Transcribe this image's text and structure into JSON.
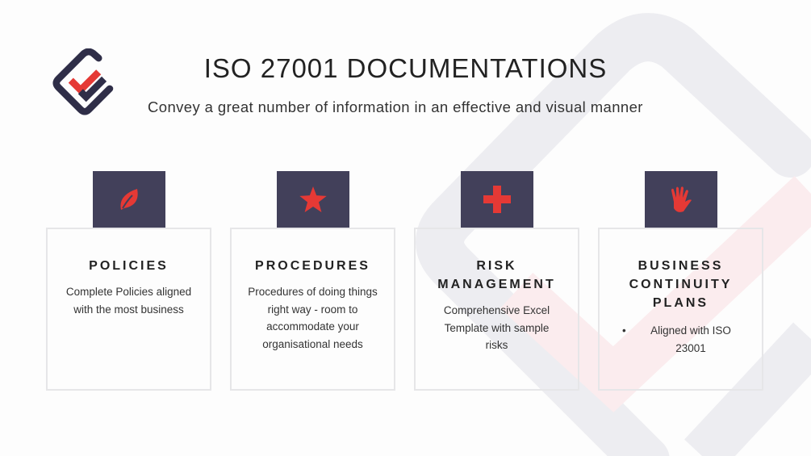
{
  "header": {
    "title": "ISO 27001 DOCUMENTATIONS",
    "subtitle": "Convey a great number of information in an effective and visual manner"
  },
  "colors": {
    "navy": "#42405a",
    "red": "#e53935"
  },
  "cards": [
    {
      "icon": "leaf-icon",
      "title": "POLICIES",
      "text": "Complete Policies aligned with the most business"
    },
    {
      "icon": "star-icon",
      "title": "PROCEDURES",
      "text": "Procedures of doing things right way - room to accommodate your organisational needs"
    },
    {
      "icon": "plus-icon",
      "title": "RISK MANAGEMENT",
      "text": "Comprehensive Excel Template with sample risks"
    },
    {
      "icon": "hand-icon",
      "title": "BUSINESS CONTINUITY PLANS",
      "bullet": "•",
      "text": "Aligned with ISO 23001"
    }
  ]
}
